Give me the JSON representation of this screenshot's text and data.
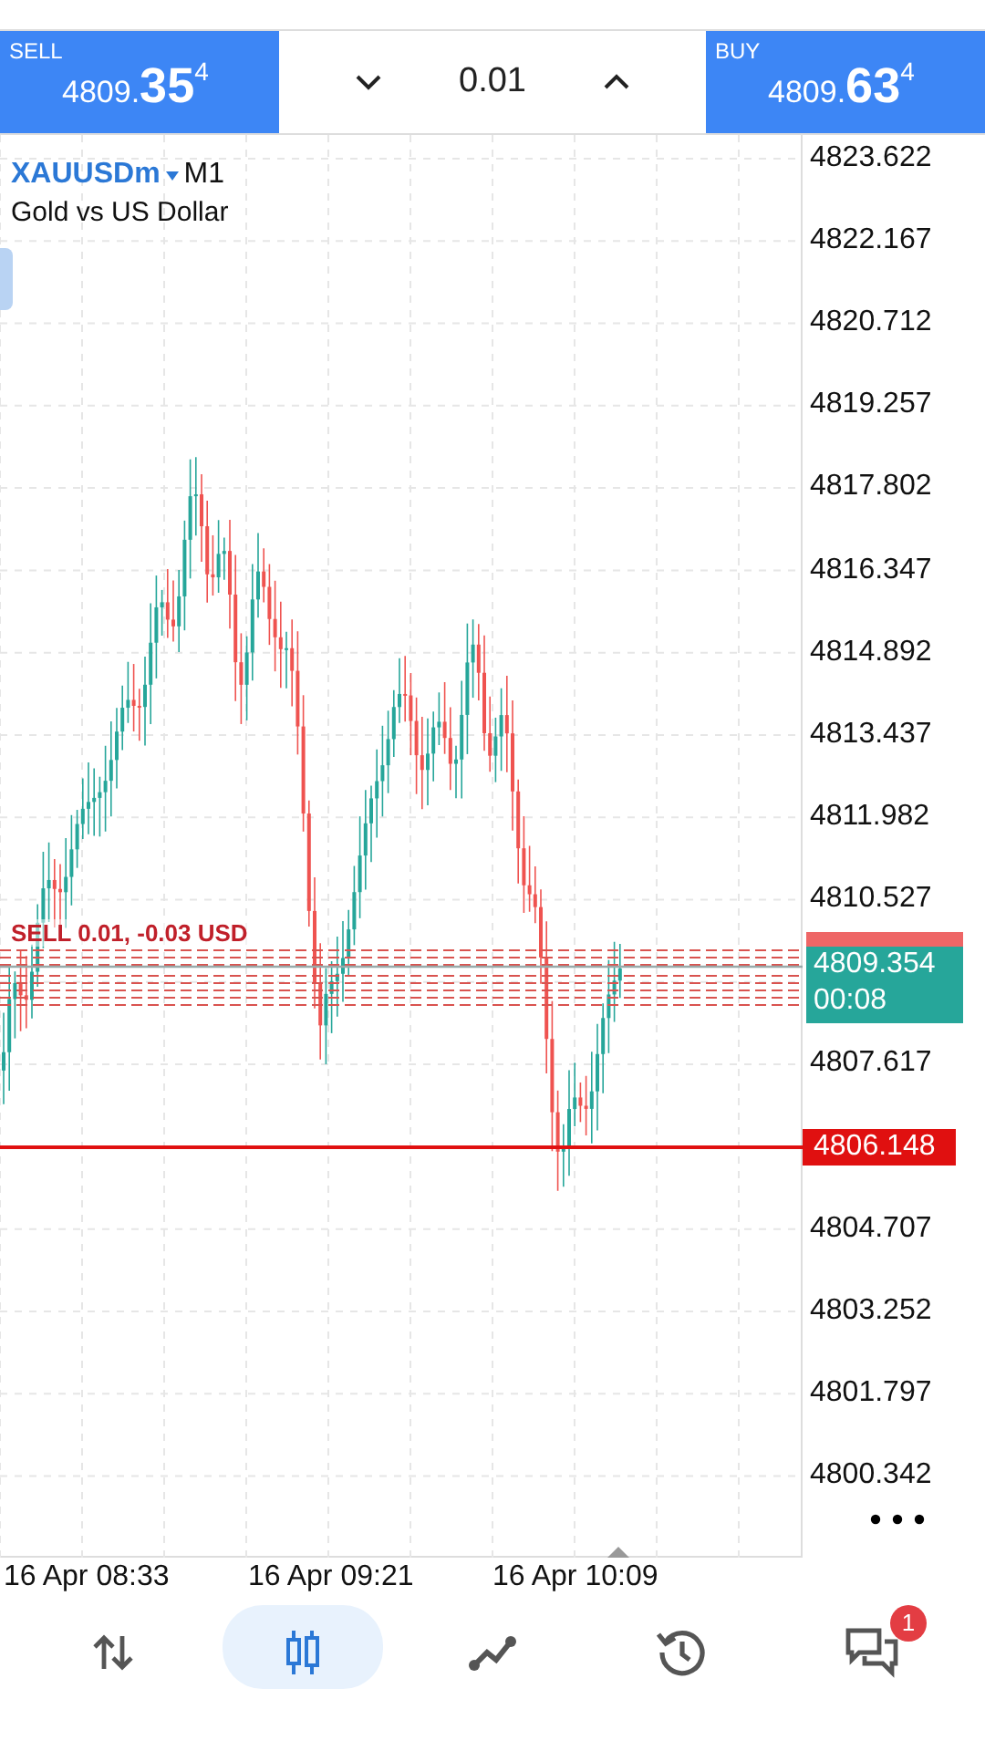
{
  "trade_bar": {
    "sell": {
      "label": "SELL",
      "price_main": "4809.",
      "price_big": "35",
      "price_sup": "4"
    },
    "volume": "0.01",
    "buy": {
      "label": "BUY",
      "price_main": "4809.",
      "price_big": "63",
      "price_sup": "4"
    }
  },
  "symbol": {
    "name": "XAUUSDm",
    "timeframe": "M1",
    "description": "Gold vs US Dollar"
  },
  "price_axis": [
    "4823.622",
    "4822.167",
    "4820.712",
    "4819.257",
    "4817.802",
    "4816.347",
    "4814.892",
    "4813.437",
    "4811.982",
    "4810.527",
    "4807.617",
    "4804.707",
    "4803.252",
    "4801.797",
    "4800.342"
  ],
  "order_label": "SELL 0.01, -0.03 USD",
  "bid_label": {
    "price": "4809.354",
    "countdown": "00:08"
  },
  "level_label": "4806.148",
  "time_axis": [
    "16 Apr 08:33",
    "16 Apr 09:21",
    "16 Apr 10:09"
  ],
  "nav": [
    {
      "kind": "quotes",
      "selected": false
    },
    {
      "kind": "chart",
      "selected": true
    },
    {
      "kind": "trade",
      "selected": false
    },
    {
      "kind": "history",
      "selected": false
    },
    {
      "kind": "messages",
      "selected": false,
      "badge": "1"
    }
  ]
}
